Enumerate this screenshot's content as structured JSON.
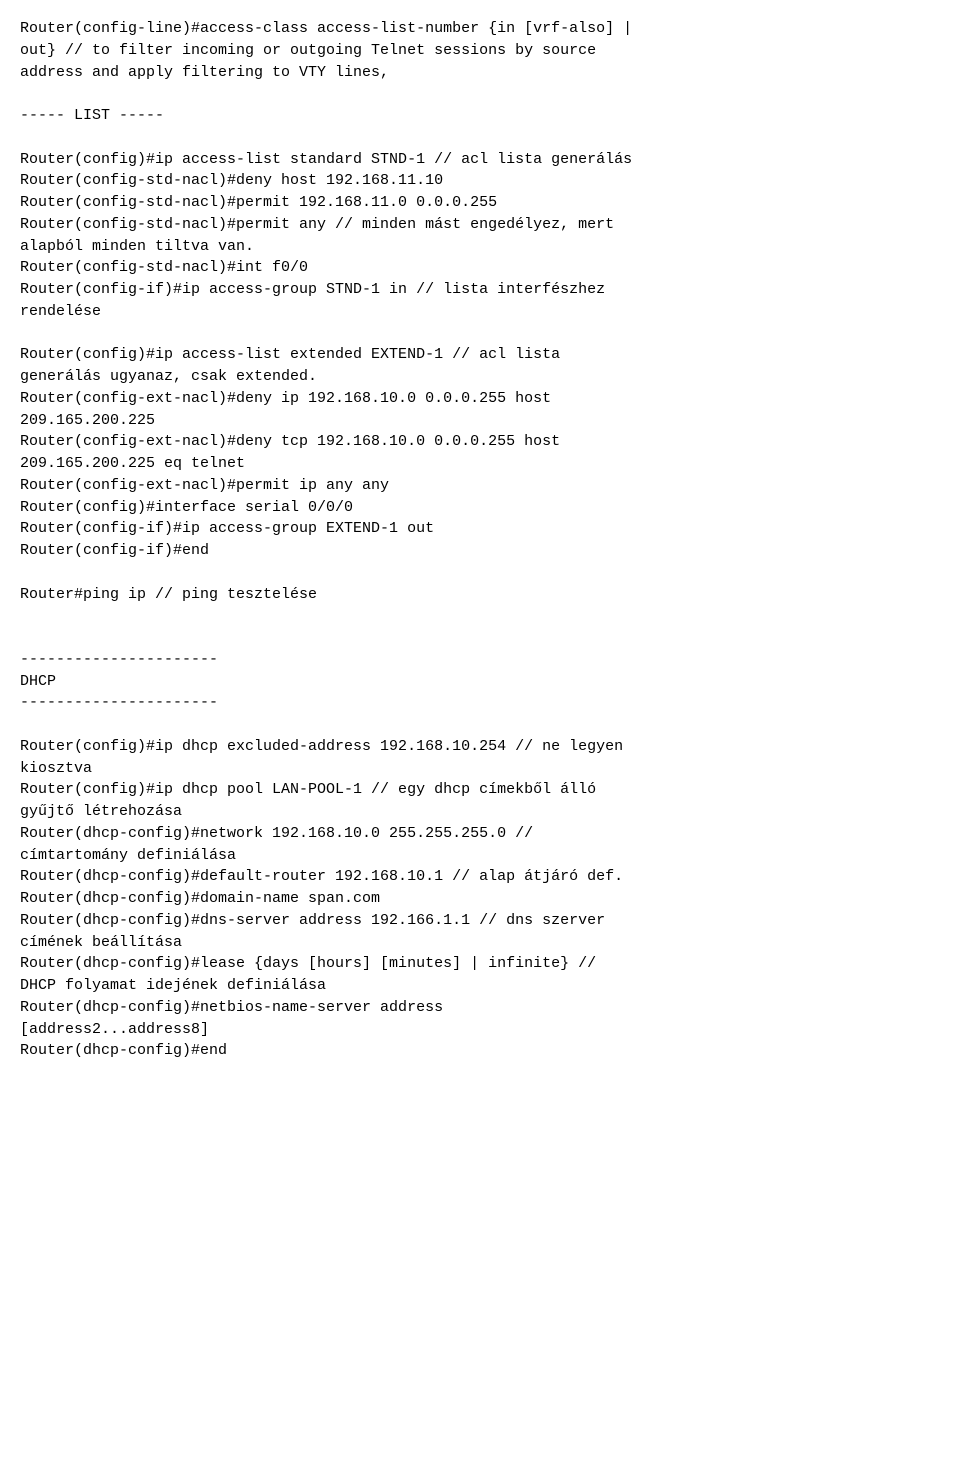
{
  "content": {
    "text": "Router(config-line)#access-class access-list-number {in [vrf-also] |\nout} // to filter incoming or outgoing Telnet sessions by source\naddress and apply filtering to VTY lines,\n\n----- LIST -----\n\nRouter(config)#ip access-list standard STND-1 // acl lista generálás\nRouter(config-std-nacl)#deny host 192.168.11.10\nRouter(config-std-nacl)#permit 192.168.11.0 0.0.0.255\nRouter(config-std-nacl)#permit any // minden mást engedélyez, mert\nalapból minden tiltva van.\nRouter(config-std-nacl)#int f0/0\nRouter(config-if)#ip access-group STND-1 in // lista interfészhez\nrendelése\n\nRouter(config)#ip access-list extended EXTEND-1 // acl lista\ngenerálás ugyanaz, csak extended.\nRouter(config-ext-nacl)#deny ip 192.168.10.0 0.0.0.255 host\n209.165.200.225\nRouter(config-ext-nacl)#deny tcp 192.168.10.0 0.0.0.255 host\n209.165.200.225 eq telnet\nRouter(config-ext-nacl)#permit ip any any\nRouter(config)#interface serial 0/0/0\nRouter(config-if)#ip access-group EXTEND-1 out\nRouter(config-if)#end\n\nRouter#ping ip // ping tesztelése\n\n\n----------------------\nDHCP\n----------------------\n\nRouter(config)#ip dhcp excluded-address 192.168.10.254 // ne legyen\nkiosztva\nRouter(config)#ip dhcp pool LAN-POOL-1 // egy dhcp címekből álló\ngyűjtő létrehozása\nRouter(dhcp-config)#network 192.168.10.0 255.255.255.0 //\ncímtartomány definiálása\nRouter(dhcp-config)#default-router 192.168.10.1 // alap átjáró def.\nRouter(dhcp-config)#domain-name span.com\nRouter(dhcp-config)#dns-server address 192.166.1.1 // dns szerver\ncímének beállítása\nRouter(dhcp-config)#lease {days [hours] [minutes] | infinite} //\nDHCP folyamat idejének definiálása\nRouter(dhcp-config)#netbios-name-server address\n[address2...address8]\nRouter(dhcp-config)#end"
  }
}
